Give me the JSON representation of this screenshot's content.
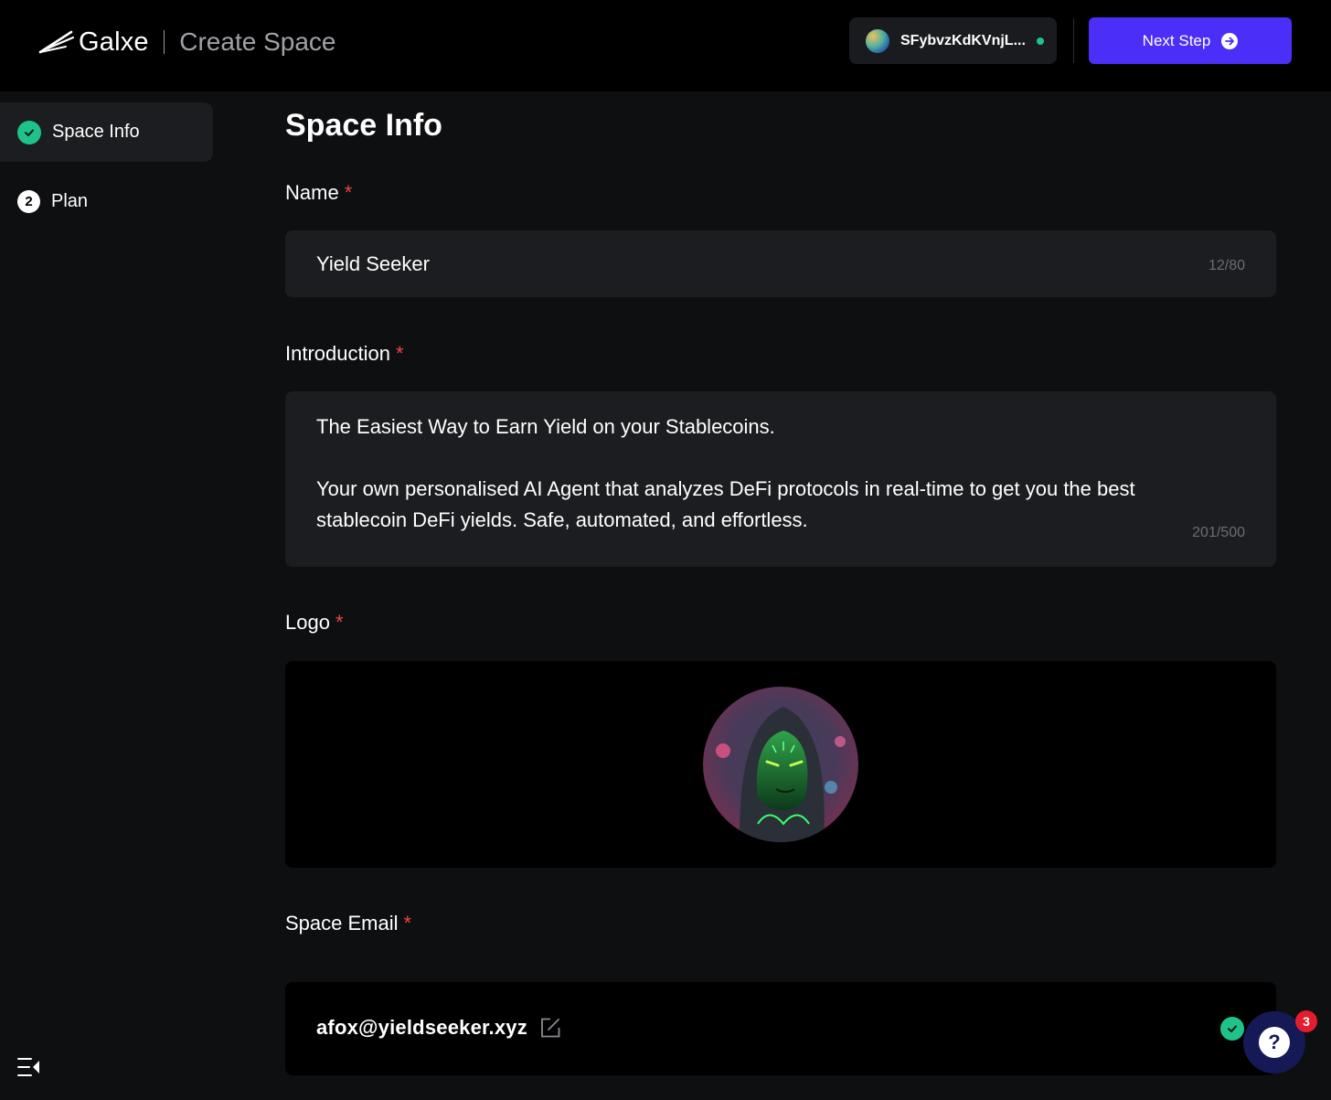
{
  "header": {
    "brand_name": "Galxe",
    "page_name": "Create Space",
    "wallet_address": "SFybvzKdKVnjL...",
    "next_label": "Next Step"
  },
  "sidebar": {
    "items": [
      {
        "label": "Space Info",
        "state": "completed"
      },
      {
        "label": "Plan",
        "step": "2"
      }
    ]
  },
  "form": {
    "title": "Space Info",
    "name": {
      "label": "Name",
      "required_mark": "*",
      "value": "Yield Seeker",
      "counter": "12/80"
    },
    "introduction": {
      "label": "Introduction",
      "required_mark": "*",
      "value": "The Easiest Way to Earn Yield on your Stablecoins.\n\nYour own personalised AI Agent that analyzes DeFi protocols in real-time to get you the best stablecoin DeFi yields. Safe, automated, and effortless.",
      "counter": "201/500"
    },
    "logo": {
      "label": "Logo",
      "required_mark": "*"
    },
    "email": {
      "label": "Space Email",
      "required_mark": "*",
      "value": "afox@yieldseeker.xyz"
    }
  },
  "help": {
    "glyph": "?",
    "badge_count": "3"
  },
  "colors": {
    "accent": "#4b2ef7",
    "success": "#1ec38a",
    "danger": "#ef4444",
    "background": "#0e0f11"
  }
}
